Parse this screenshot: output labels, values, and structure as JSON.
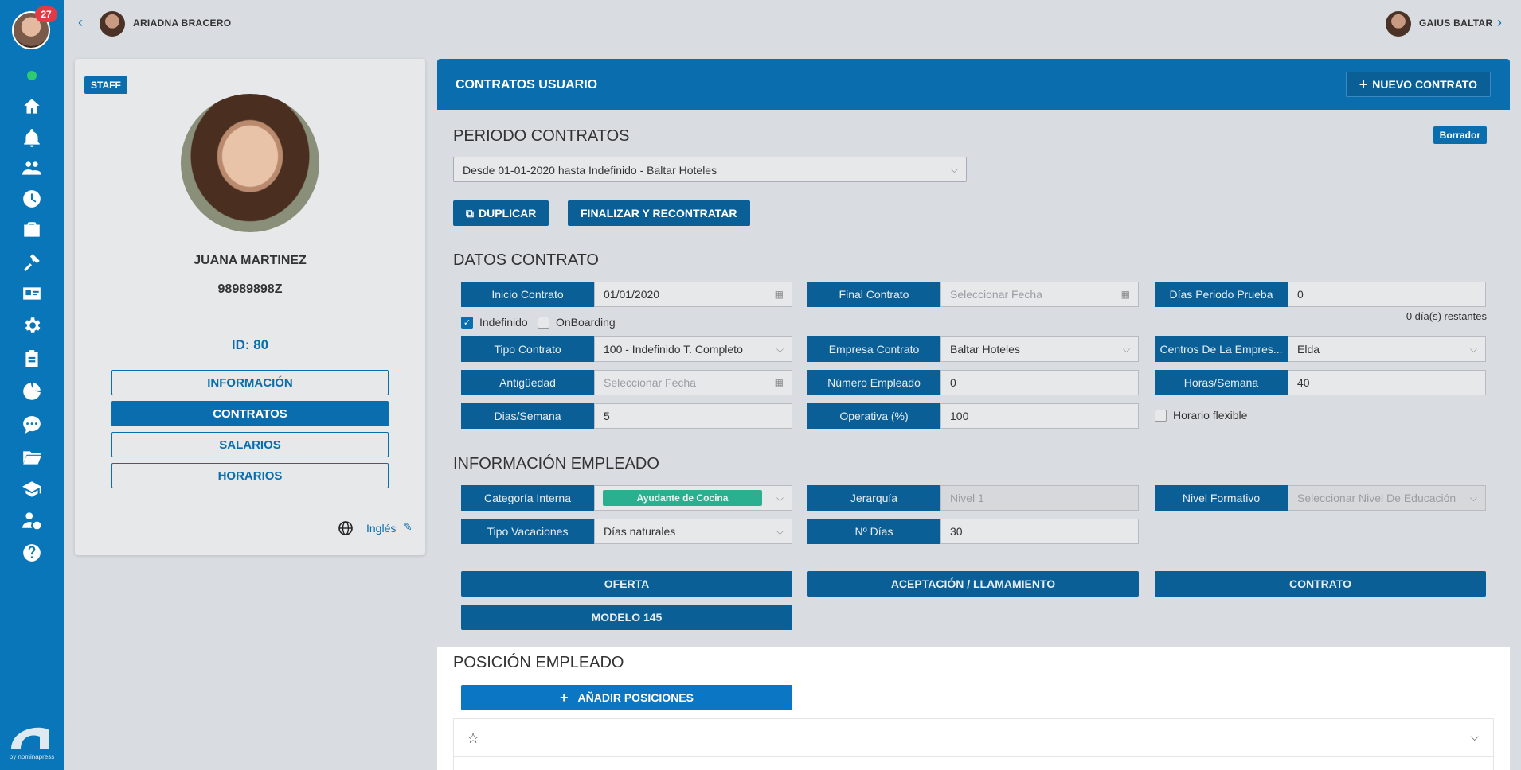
{
  "rail": {
    "notification_count": "27",
    "icons": [
      "home-icon",
      "bell-icon",
      "users-icon",
      "clock-icon",
      "briefcase-icon",
      "tools-icon",
      "id-card-icon",
      "gear-icon",
      "clipboard-icon",
      "pie-chart-icon",
      "chat-icon",
      "folder-icon",
      "graduation-cap-icon",
      "user-money-icon",
      "help-icon"
    ],
    "brand_caption": "by nominapress"
  },
  "topbar": {
    "prev_user": "ARIADNA BRACERO",
    "next_user": "GAIUS BALTAR"
  },
  "profile": {
    "badge": "STAFF",
    "name": "JUANA MARTINEZ",
    "dni": "98989898Z",
    "id_label": "ID: 80",
    "buttons": [
      "INFORMACIÓN",
      "CONTRATOS",
      "SALARIOS",
      "HORARIOS"
    ],
    "language": "Inglés"
  },
  "main": {
    "title": "CONTRATOS USUARIO",
    "new_contract": "NUEVO CONTRATO",
    "period_title": "PERIODO CONTRATOS",
    "status_badge": "Borrador",
    "period_value": "Desde 01-01-2020 hasta Indefinido - Baltar Hoteles",
    "duplicate": "DUPLICAR",
    "finalize": "FINALIZAR Y RECONTRATAR",
    "contract_title": "DATOS CONTRATO",
    "fields": {
      "inicio_label": "Inicio Contrato",
      "inicio_value": "01/01/2020",
      "final_label": "Final Contrato",
      "final_placeholder": "Seleccionar Fecha",
      "prueba_label": "Días Periodo Prueba",
      "prueba_value": "0",
      "tipo_label": "Tipo Contrato",
      "tipo_value": "100 - Indefinido T. Completo",
      "empresa_label": "Empresa Contrato",
      "empresa_value": "Baltar Hoteles",
      "centros_label": "Centros De La Empres...",
      "centros_value": "Elda",
      "antig_label": "Antigüedad",
      "antig_placeholder": "Seleccionar Fecha",
      "numemp_label": "Número Empleado",
      "numemp_value": "0",
      "horas_label": "Horas/Semana",
      "horas_value": "40",
      "dias_label": "Dias/Semana",
      "dias_value": "5",
      "operativa_label": "Operativa (%)",
      "operativa_value": "100"
    },
    "indefinido": "Indefinido",
    "onboarding": "OnBoarding",
    "remaining": "0 día(s) restantes",
    "horario_flexible": "Horario flexible",
    "employee_title": "INFORMACIÓN EMPLEADO",
    "emp": {
      "cat_label": "Categoría Interna",
      "cat_value": "Ayudante de Cocina",
      "jer_label": "Jerarquía",
      "jer_value": "Nivel 1",
      "nivel_label": "Nivel Formativo",
      "nivel_placeholder": "Seleccionar Nivel De Educación",
      "vac_label": "Tipo Vacaciones",
      "vac_value": "Días naturales",
      "ndias_label": "Nº Días",
      "ndias_value": "30"
    },
    "docs": [
      "OFERTA",
      "ACEPTACIÓN / LLAMAMIENTO",
      "CONTRATO",
      "MODELO 145"
    ],
    "position_title": "POSICIÓN EMPLEADO",
    "add_positions": "AÑADIR POSICIONES"
  }
}
